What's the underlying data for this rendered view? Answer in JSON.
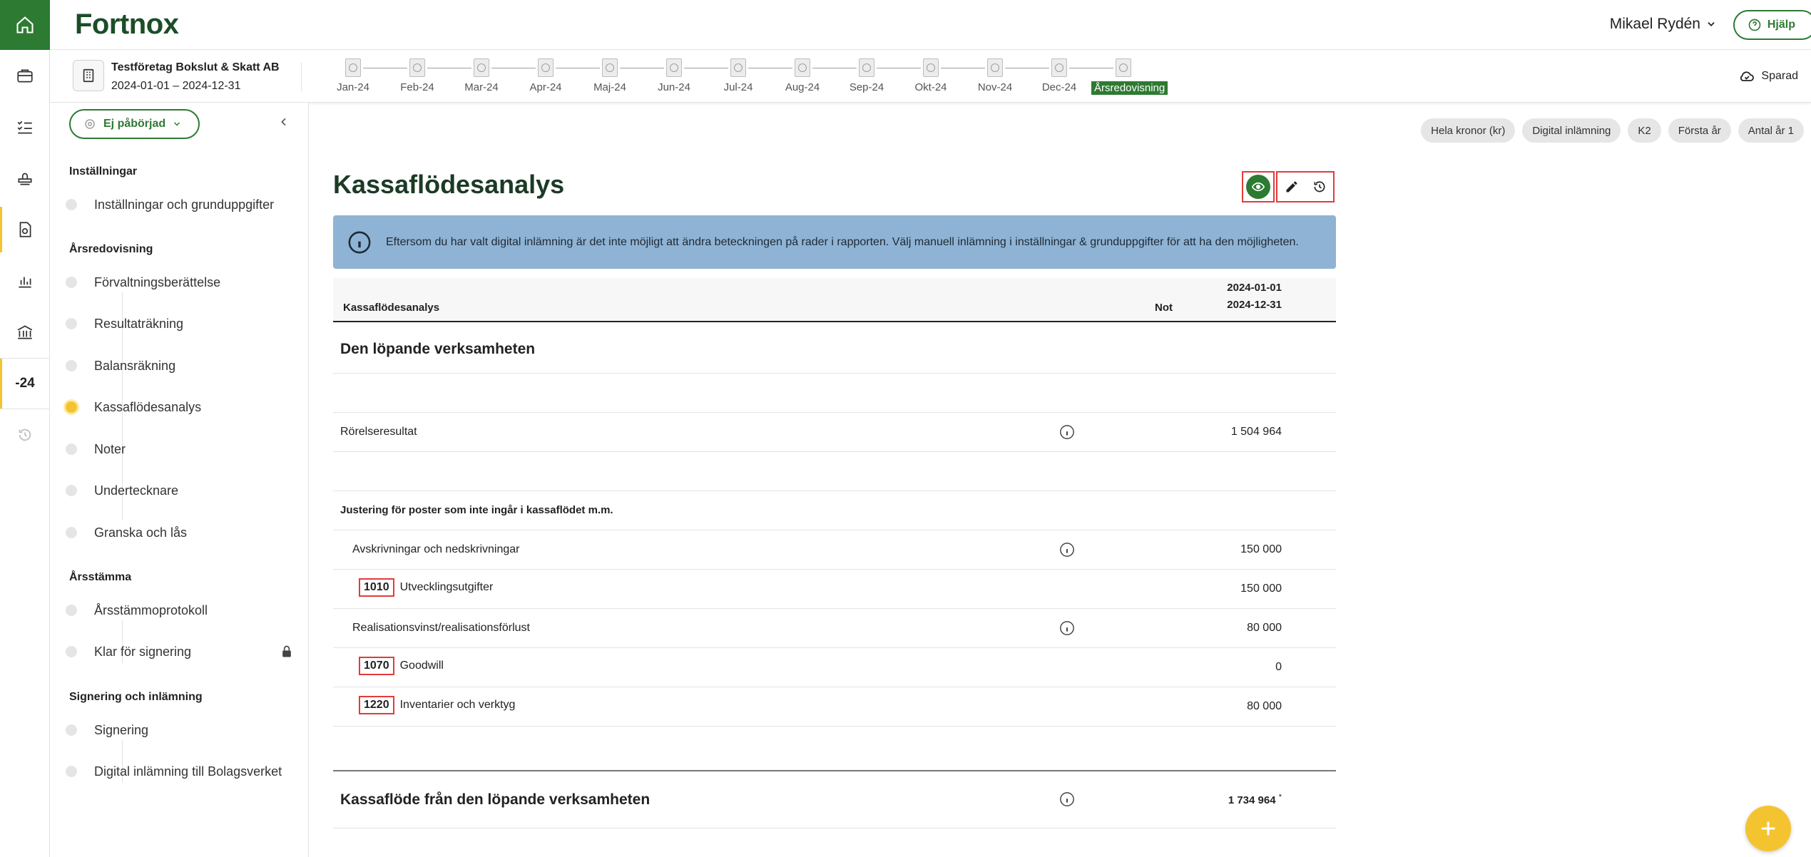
{
  "app": {
    "logo": "Fortnox"
  },
  "header": {
    "user_name": "Mikael Rydén",
    "help_label": "Hjälp"
  },
  "rail": {
    "year_label": "-24"
  },
  "company": {
    "name": "Testföretag Bokslut & Skatt AB",
    "range": "2024-01-01 – 2024-12-31"
  },
  "periods": [
    "Jan-24",
    "Feb-24",
    "Mar-24",
    "Apr-24",
    "Maj-24",
    "Jun-24",
    "Jul-24",
    "Aug-24",
    "Sep-24",
    "Okt-24",
    "Nov-24",
    "Dec-24",
    "Årsredovisning"
  ],
  "save_status": "Sparad",
  "sidebar": {
    "status_label": "Ej påbörjad",
    "sections": {
      "s1": "Inställningar",
      "s2": "Årsredovisning",
      "s3": "Årsstämma",
      "s4": "Signering och inlämning"
    },
    "items": {
      "i1": "Inställningar och grunduppgifter",
      "i2": "Förvaltningsberättelse",
      "i3": "Resultaträkning",
      "i4": "Balansräkning",
      "i5": "Kassaflödesanalys",
      "i6": "Noter",
      "i7": "Undertecknare",
      "i8": "Granska och lås",
      "i9": "Årsstämmoprotokoll",
      "i10": "Klar för signering",
      "i11": "Signering",
      "i12": "Digital inlämning till Bolagsverket"
    }
  },
  "chips": [
    "Hela kronor (kr)",
    "Digital inlämning",
    "K2",
    "Första år",
    "Antal år 1"
  ],
  "page": {
    "title": "Kassaflödesanalys",
    "banner": "Eftersom du har valt digital inlämning är det inte möjligt att ändra beteckningen på rader i rapporten. Välj manuell inlämning i inställningar & grunduppgifter för att ha den möjligheten."
  },
  "table": {
    "col_name": "Kassaflödesanalys",
    "col_not": "Not",
    "col_date_from": "2024-01-01",
    "col_date_to": "2024-12-31",
    "section_title": "Den löpande verksamheten",
    "rows": {
      "r1_label": "Rörelseresultat",
      "r1_amount": "1 504 964",
      "r2_label": "Justering för poster som inte ingår i kassaflödet m.m.",
      "r3_label": "Avskrivningar och nedskrivningar",
      "r3_amount": "150 000",
      "r4_acc": "1010",
      "r4_label": "Utvecklingsutgifter",
      "r4_amount": "150 000",
      "r5_label": "Realisationsvinst/realisationsförlust",
      "r5_amount": "80 000",
      "r6_acc": "1070",
      "r6_label": "Goodwill",
      "r6_amount": "0",
      "r7_acc": "1220",
      "r7_label": "Inventarier och verktyg",
      "r7_amount": "80 000"
    },
    "total_label": "Kassaflöde från den löpande verksamheten",
    "total_amount": "1 734 964",
    "total_marker": "*"
  },
  "colors": {
    "brand_green": "#2d7a32",
    "accent_yellow": "#f4c430",
    "banner_blue": "#8fb3d4",
    "highlight_red": "#e23b3b"
  }
}
